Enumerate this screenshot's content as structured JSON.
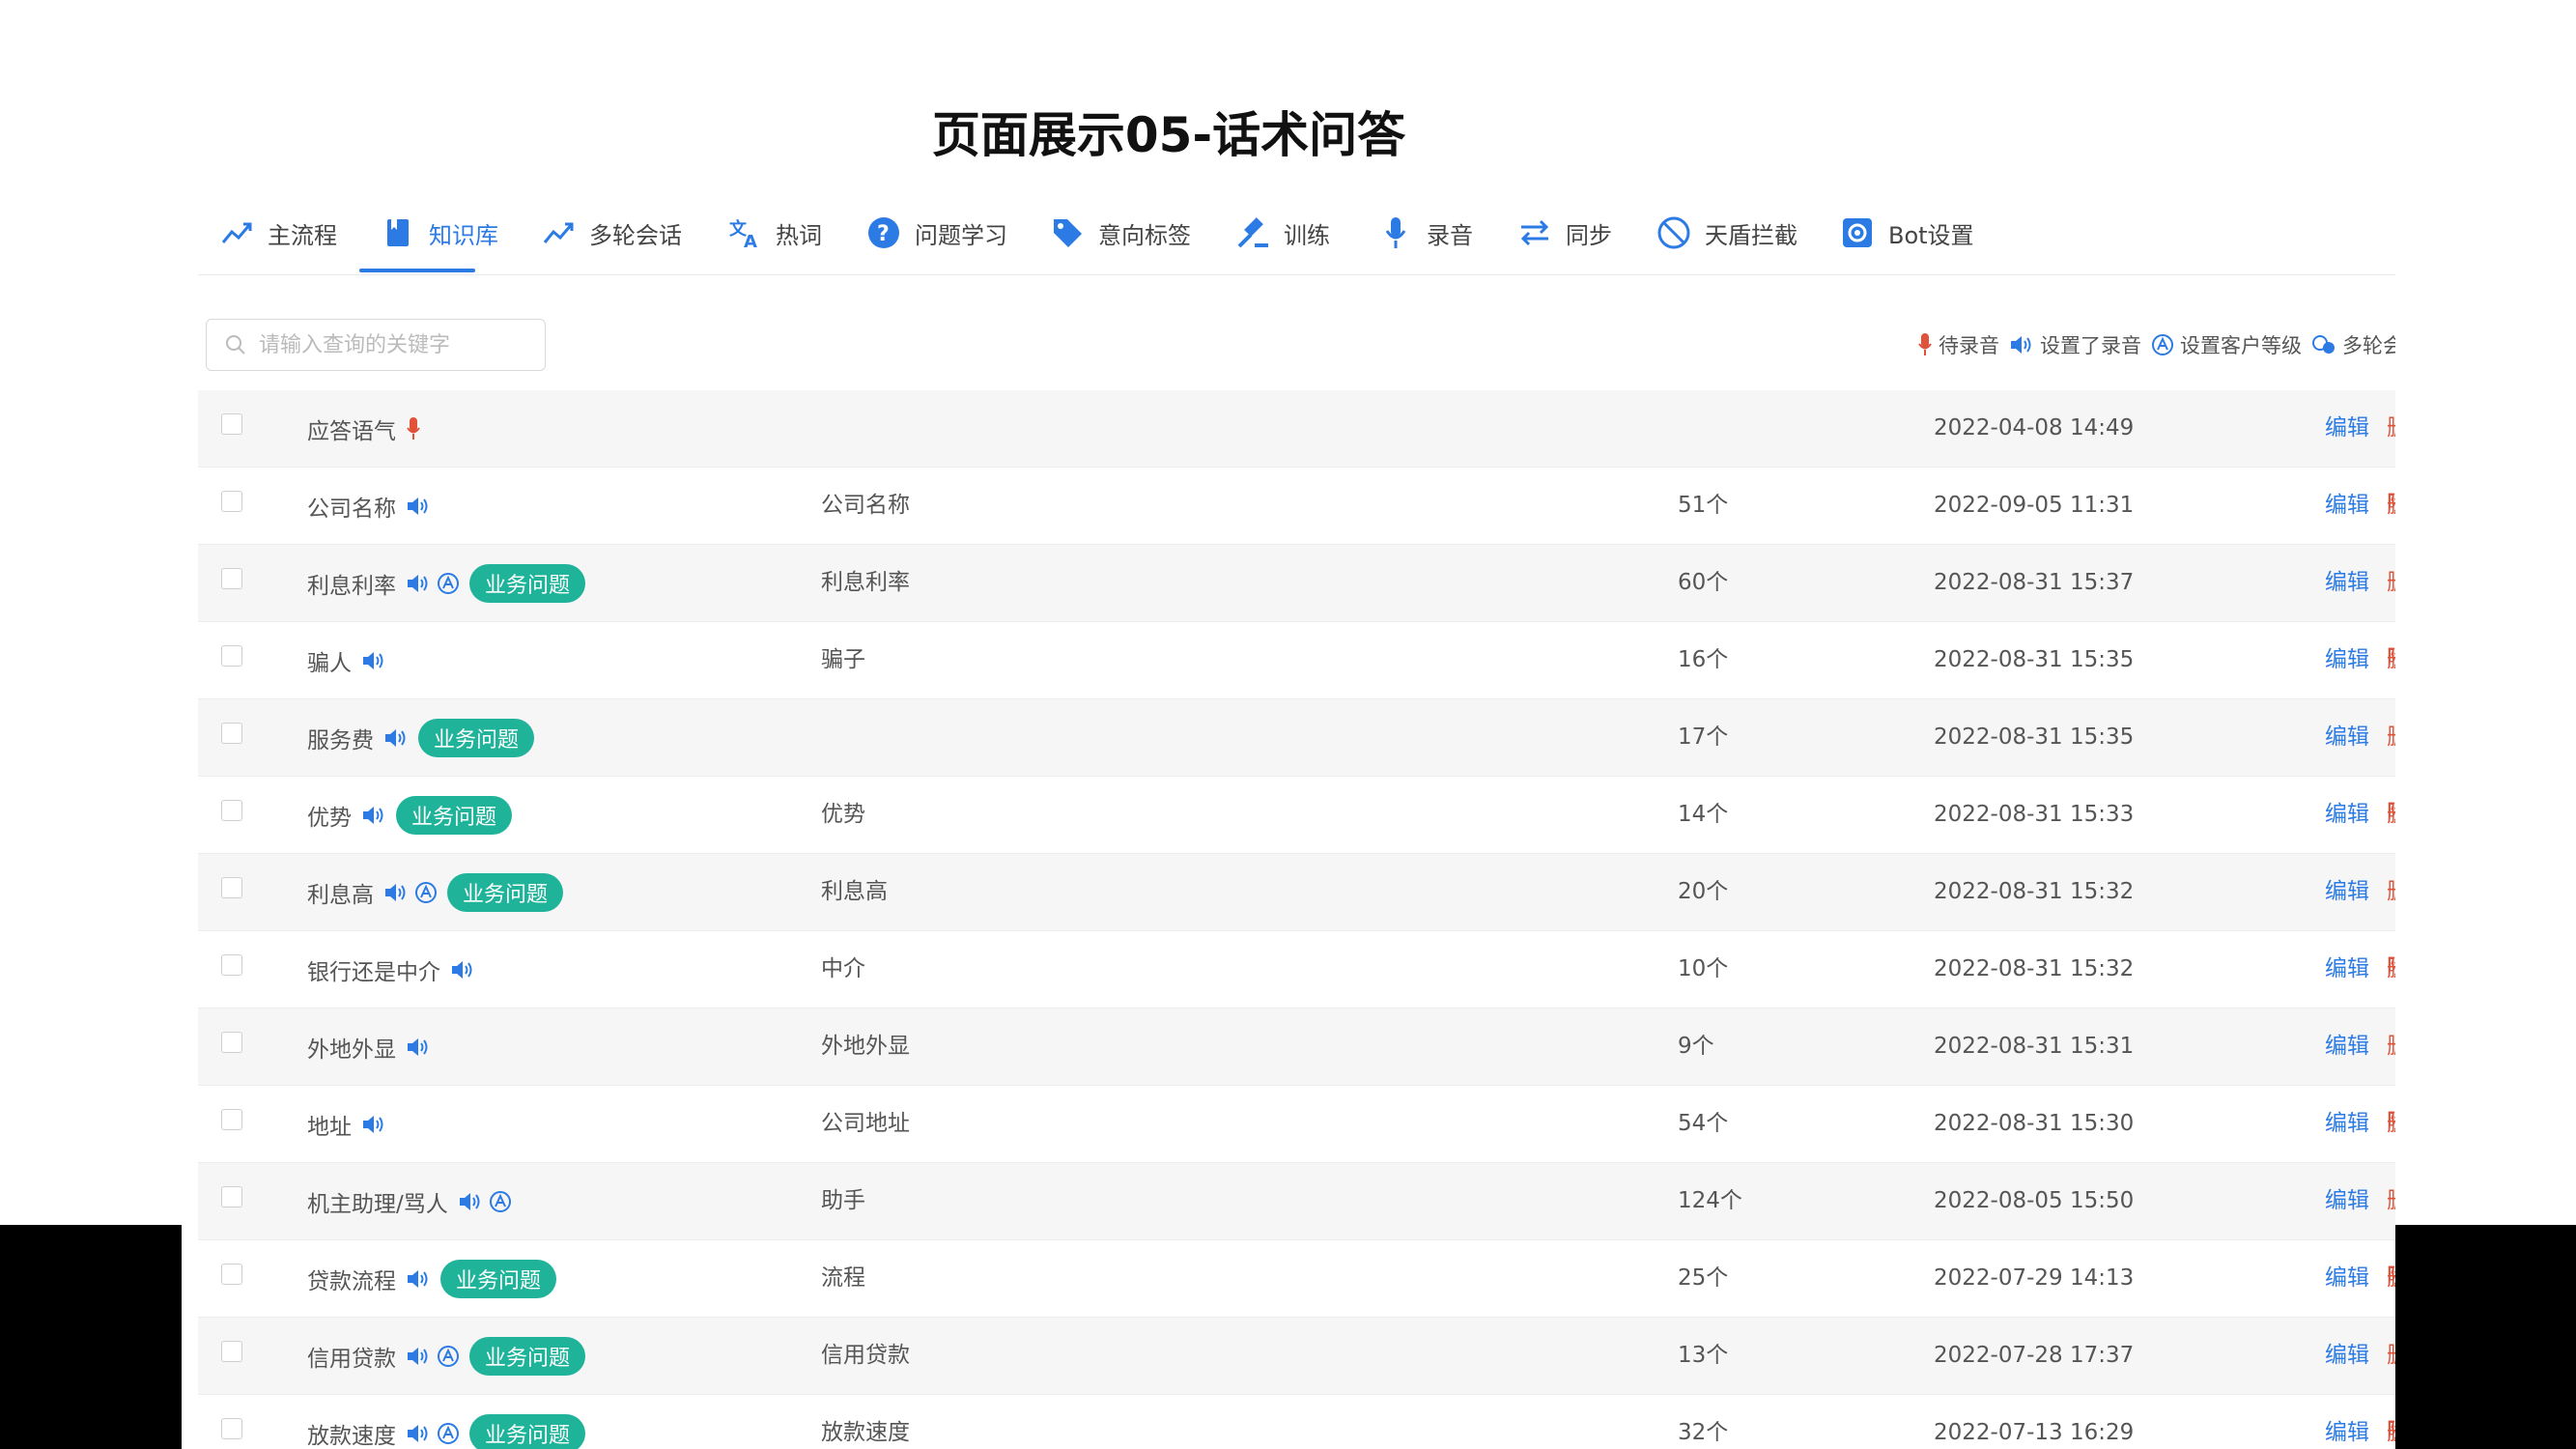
{
  "slide_title": "页面展示05-话术问答",
  "tabs": [
    {
      "label": "主流程",
      "icon": "trend-line-icon"
    },
    {
      "label": "知识库",
      "icon": "book-icon",
      "active": true
    },
    {
      "label": "多轮会话",
      "icon": "trend-line-icon"
    },
    {
      "label": "热词",
      "icon": "translate-icon"
    },
    {
      "label": "问题学习",
      "icon": "question-circle-icon"
    },
    {
      "label": "意向标签",
      "icon": "tag-icon"
    },
    {
      "label": "训练",
      "icon": "gavel-icon"
    },
    {
      "label": "录音",
      "icon": "microphone-icon"
    },
    {
      "label": "同步",
      "icon": "sync-arrows-icon"
    },
    {
      "label": "天盾拦截",
      "icon": "block-icon"
    },
    {
      "label": "Bot设置",
      "icon": "gear-icon"
    }
  ],
  "search": {
    "placeholder": "请输入查询的关键字"
  },
  "legend": {
    "pending": "待录音",
    "recorded": "设置了录音",
    "level": "设置客户等级",
    "multi": "多轮会话"
  },
  "badge_label": "业务问题",
  "actions": {
    "edit": "编辑",
    "delete": "删除"
  },
  "colors": {
    "accent": "#2c7be5",
    "badge": "#1fb39a",
    "mic": "#e0533a",
    "delete": "#e0533a"
  },
  "rows": [
    {
      "name": "应答语气",
      "mic": true,
      "speaker": false,
      "level": false,
      "badge": false,
      "keyword": "",
      "count": "",
      "date": "2022-04-08 14:49"
    },
    {
      "name": "公司名称",
      "mic": false,
      "speaker": true,
      "level": false,
      "badge": false,
      "keyword": "公司名称",
      "count": "51个",
      "date": "2022-09-05 11:31"
    },
    {
      "name": "利息利率",
      "mic": false,
      "speaker": true,
      "level": true,
      "badge": true,
      "keyword": "利息利率",
      "count": "60个",
      "date": "2022-08-31 15:37"
    },
    {
      "name": "骗人",
      "mic": false,
      "speaker": true,
      "level": false,
      "badge": false,
      "keyword": "骗子",
      "count": "16个",
      "date": "2022-08-31 15:35"
    },
    {
      "name": "服务费",
      "mic": false,
      "speaker": true,
      "level": false,
      "badge": true,
      "keyword": "",
      "count": "17个",
      "date": "2022-08-31 15:35"
    },
    {
      "name": "优势",
      "mic": false,
      "speaker": true,
      "level": false,
      "badge": true,
      "keyword": "优势",
      "count": "14个",
      "date": "2022-08-31 15:33"
    },
    {
      "name": "利息高",
      "mic": false,
      "speaker": true,
      "level": true,
      "badge": true,
      "keyword": "利息高",
      "count": "20个",
      "date": "2022-08-31 15:32"
    },
    {
      "name": "银行还是中介",
      "mic": false,
      "speaker": true,
      "level": false,
      "badge": false,
      "keyword": "中介",
      "count": "10个",
      "date": "2022-08-31 15:32"
    },
    {
      "name": "外地外显",
      "mic": false,
      "speaker": true,
      "level": false,
      "badge": false,
      "keyword": "外地外显",
      "count": "9个",
      "date": "2022-08-31 15:31"
    },
    {
      "name": "地址",
      "mic": false,
      "speaker": true,
      "level": false,
      "badge": false,
      "keyword": "公司地址",
      "count": "54个",
      "date": "2022-08-31 15:30"
    },
    {
      "name": "机主助理/骂人",
      "mic": false,
      "speaker": true,
      "level": true,
      "badge": false,
      "keyword": "助手",
      "count": "124个",
      "date": "2022-08-05 15:50"
    },
    {
      "name": "贷款流程",
      "mic": false,
      "speaker": true,
      "level": false,
      "badge": true,
      "keyword": "流程",
      "count": "25个",
      "date": "2022-07-29 14:13"
    },
    {
      "name": "信用贷款",
      "mic": false,
      "speaker": true,
      "level": true,
      "badge": true,
      "keyword": "信用贷款",
      "count": "13个",
      "date": "2022-07-28 17:37"
    },
    {
      "name": "放款速度",
      "mic": false,
      "speaker": true,
      "level": true,
      "badge": true,
      "keyword": "放款速度",
      "count": "32个",
      "date": "2022-07-13 16:29"
    }
  ]
}
